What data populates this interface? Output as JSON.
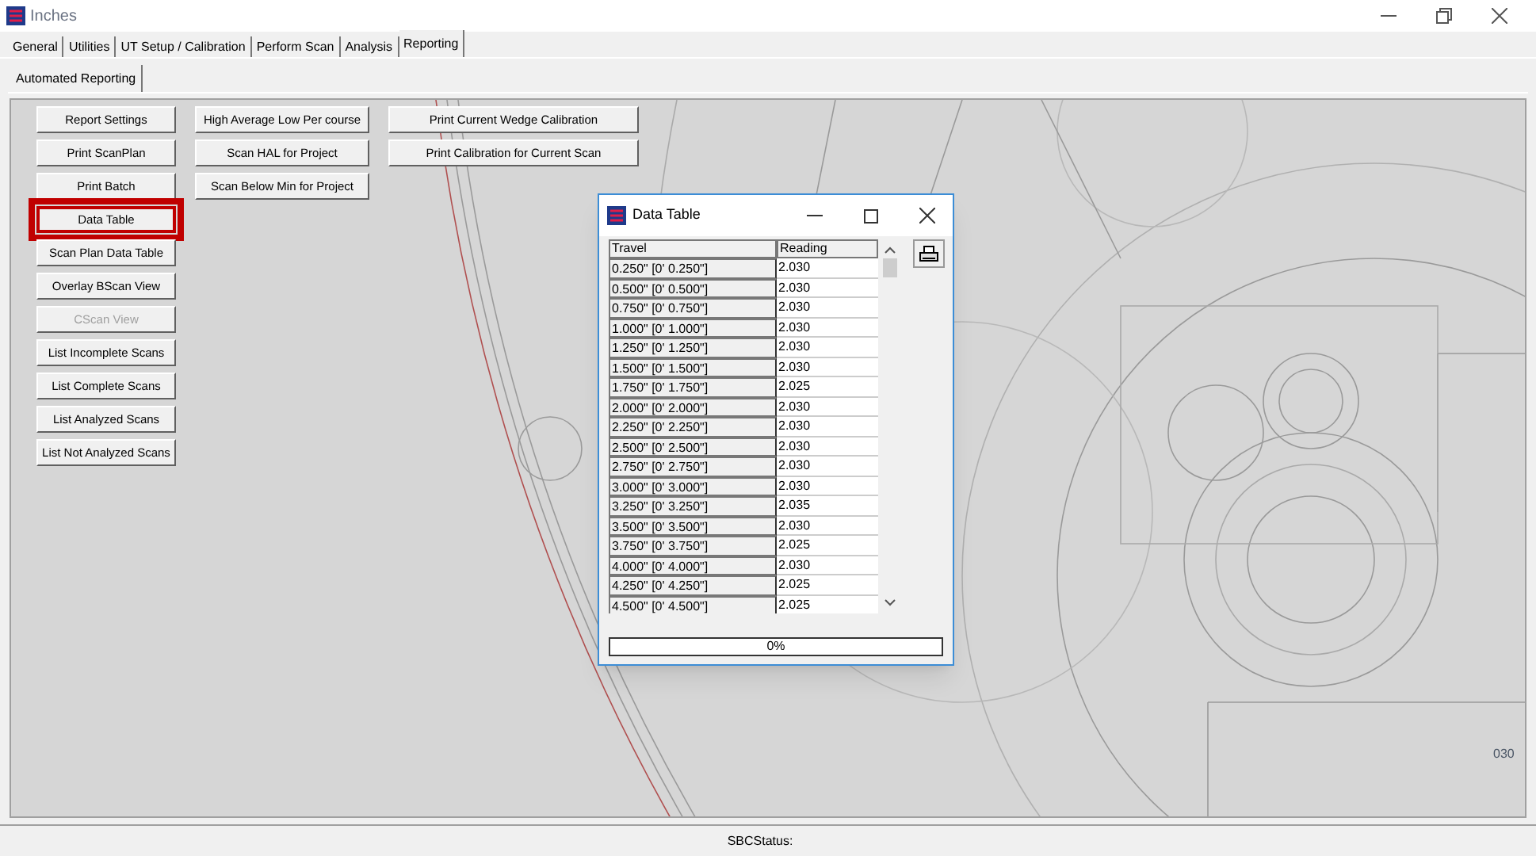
{
  "window": {
    "title": "Inches"
  },
  "tabs": [
    {
      "label": "General",
      "selected": false
    },
    {
      "label": "Utilities",
      "selected": false
    },
    {
      "label": "UT Setup / Calibration",
      "selected": false
    },
    {
      "label": "Perform Scan",
      "selected": false
    },
    {
      "label": "Analysis",
      "selected": false
    },
    {
      "label": "Reporting",
      "selected": true
    }
  ],
  "subtabs": [
    {
      "label": "Automated Reporting",
      "selected": true
    }
  ],
  "button_columns": [
    [
      {
        "label": "Report Settings",
        "disabled": false,
        "highlighted": false
      },
      {
        "label": "Print ScanPlan",
        "disabled": false,
        "highlighted": false
      },
      {
        "label": "Print Batch",
        "disabled": false,
        "highlighted": false
      },
      {
        "label": "Data Table",
        "disabled": false,
        "highlighted": true
      },
      {
        "label": "Scan Plan Data Table",
        "disabled": false,
        "highlighted": false
      },
      {
        "label": "Overlay BScan View",
        "disabled": false,
        "highlighted": false
      },
      {
        "label": "CScan View",
        "disabled": true,
        "highlighted": false
      },
      {
        "label": "List Incomplete Scans",
        "disabled": false,
        "highlighted": false
      },
      {
        "label": "List Complete Scans",
        "disabled": false,
        "highlighted": false
      },
      {
        "label": "List Analyzed Scans",
        "disabled": false,
        "highlighted": false
      },
      {
        "label": "List Not Analyzed Scans",
        "disabled": false,
        "highlighted": false
      }
    ],
    [
      {
        "label": "High Average Low Per course",
        "disabled": false,
        "highlighted": false
      },
      {
        "label": "Scan HAL for Project",
        "disabled": false,
        "highlighted": false
      },
      {
        "label": "Scan Below Min for Project",
        "disabled": false,
        "highlighted": false
      }
    ],
    [
      {
        "label": "Print Current Wedge Calibration",
        "disabled": false,
        "highlighted": false
      },
      {
        "label": "Print Calibration for Current Scan",
        "disabled": false,
        "highlighted": false
      }
    ]
  ],
  "drawing_label": "030",
  "dialog": {
    "title": "Data Table",
    "columns": [
      "Travel",
      "Reading"
    ],
    "rows": [
      [
        "0.250\" [0' 0.250\"]",
        "2.030"
      ],
      [
        "0.500\" [0' 0.500\"]",
        "2.030"
      ],
      [
        "0.750\" [0' 0.750\"]",
        "2.030"
      ],
      [
        "1.000\" [0' 1.000\"]",
        "2.030"
      ],
      [
        "1.250\" [0' 1.250\"]",
        "2.030"
      ],
      [
        "1.500\" [0' 1.500\"]",
        "2.030"
      ],
      [
        "1.750\" [0' 1.750\"]",
        "2.025"
      ],
      [
        "2.000\" [0' 2.000\"]",
        "2.030"
      ],
      [
        "2.250\" [0' 2.250\"]",
        "2.030"
      ],
      [
        "2.500\" [0' 2.500\"]",
        "2.030"
      ],
      [
        "2.750\" [0' 2.750\"]",
        "2.030"
      ],
      [
        "3.000\" [0' 3.000\"]",
        "2.030"
      ],
      [
        "3.250\" [0' 3.250\"]",
        "2.035"
      ],
      [
        "3.500\" [0' 3.500\"]",
        "2.030"
      ],
      [
        "3.750\" [0' 3.750\"]",
        "2.025"
      ],
      [
        "4.000\" [0' 4.000\"]",
        "2.030"
      ],
      [
        "4.250\" [0' 4.250\"]",
        "2.025"
      ],
      [
        "4.500\" [0' 4.500\"]",
        "2.025"
      ]
    ],
    "progress": {
      "level": 0,
      "reading": "0%"
    }
  },
  "status_bar": {
    "text": "SBCStatus:"
  }
}
